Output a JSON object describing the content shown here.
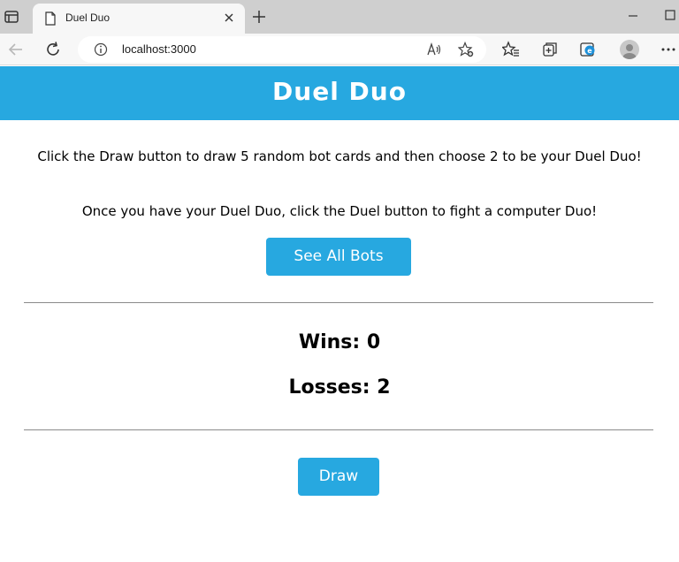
{
  "browser": {
    "tab_title": "Duel Duo",
    "url": "localhost:3000"
  },
  "header": {
    "title": "Duel Duo",
    "background_color": "#27a8e0"
  },
  "instructions": {
    "line1": "Click the Draw button to draw 5 random bot cards and then choose 2 to be your Duel Duo!",
    "line2": "Once you have your Duel Duo, click the Duel button to fight a computer Duo!"
  },
  "buttons": {
    "see_all_bots": "See All Bots",
    "draw": "Draw"
  },
  "stats": {
    "wins": "Wins: 0",
    "losses": "Losses: 2"
  },
  "accent_color": "#27a8e0"
}
